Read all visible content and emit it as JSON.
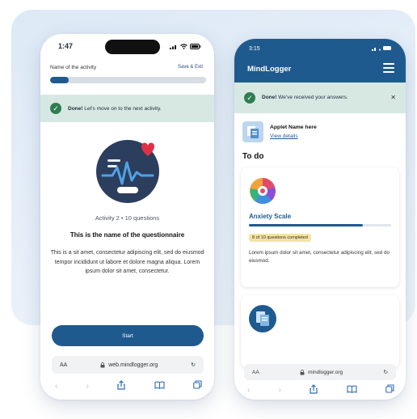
{
  "left_phone": {
    "status": {
      "time": "1:47",
      "icons": "signal-wifi-battery"
    },
    "activity_name": "Name of the activity",
    "save_exit_label": "Save & Exit",
    "progress_fraction": 0.12,
    "banner": {
      "strong": "Done!",
      "text": "Let's move on to the next activity."
    },
    "hero_icon": "heartbeat-monitor-icon",
    "meta": "Activity 2 • 10 questions",
    "title": "This is the name of the questionnaire",
    "description": "This is a sit amet, consectetur adipiscing elit, sed do eiusmod tempor incididunt ut labore et dolore magna aliqua. Lorem ipsum dolor sit amet, consectetur.",
    "start_label": "Start",
    "url": {
      "aa": "AA",
      "address": "web.mindlogger.org"
    }
  },
  "right_phone": {
    "status": {
      "time": "3:15"
    },
    "brand": "MindLogger",
    "banner": {
      "strong": "Done!",
      "text": "We've received your answers."
    },
    "applet": {
      "name": "Applet Name here",
      "link": "View details"
    },
    "todo_title": "To do",
    "card": {
      "title": "Anxiety Scale",
      "progress_fraction": 0.8,
      "chip": "8 of 10 questions completed",
      "description": "Lorem ipsum dolor sit amet, consectetur adipiscing elit, sed do eiusmod."
    },
    "url": {
      "aa": "AA",
      "address": "mindlogger.org"
    }
  },
  "colors": {
    "primary": "#1f5a8f",
    "success_banner": "#d7e8e3",
    "success": "#2f7d4f",
    "chip": "#f4e3a5",
    "backdrop": "#dde9f6"
  }
}
